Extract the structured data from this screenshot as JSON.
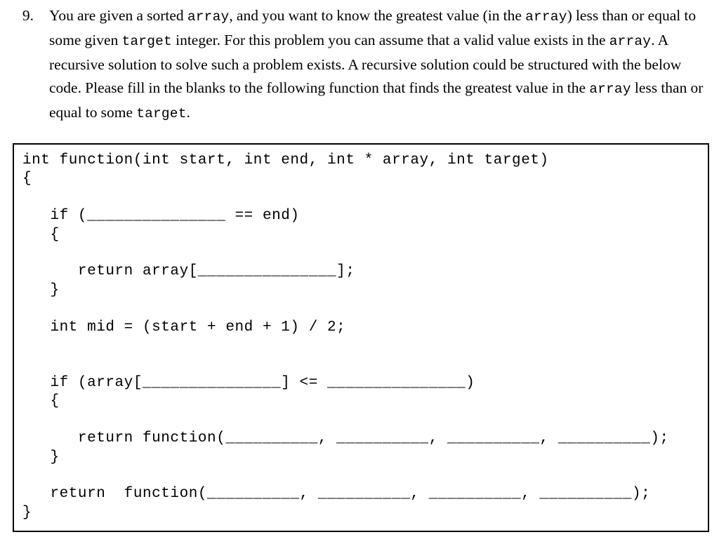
{
  "question": {
    "number": "9.",
    "segments": [
      {
        "type": "text",
        "value": "You are given a sorted "
      },
      {
        "type": "code",
        "value": "array"
      },
      {
        "type": "text",
        "value": ", and you want to know the greatest value (in the "
      },
      {
        "type": "code",
        "value": "array"
      },
      {
        "type": "text",
        "value": ") less than or equal to some given "
      },
      {
        "type": "code",
        "value": "target"
      },
      {
        "type": "text",
        "value": " integer. For this problem you can assume that a valid value exists in the "
      },
      {
        "type": "code",
        "value": "array"
      },
      {
        "type": "text",
        "value": ". A recursive solution to solve such a problem exists. A recursive solution could be structured with the below code. Please fill in the blanks to the following function that finds the greatest value in the "
      },
      {
        "type": "code",
        "value": "array"
      },
      {
        "type": "text",
        "value": " less than or equal to some "
      },
      {
        "type": "code",
        "value": "target"
      },
      {
        "type": "text",
        "value": "."
      }
    ],
    "plain_text": "You are given a sorted array, and you want to know the greatest value (in the array) less than or equal to some given target integer. For this problem you can assume that a valid value exists in the array. A recursive solution to solve such a problem exists. A recursive solution could be structured with the below code. Please fill in the blanks to the following function that finds the greatest value in the array less than or equal to some target."
  },
  "code_block": {
    "language": "C",
    "lines": [
      "int function(int start, int end, int * array, int target)",
      "{",
      "",
      "   if (_______________ == end)",
      "   {",
      "",
      "      return array[_______________];",
      "   }",
      "",
      "   int mid = (start + end + 1) / 2;",
      "",
      "",
      "   if (array[_______________] <= _______________)",
      "   {",
      "",
      "      return function(__________, __________, __________, __________);",
      "   }",
      "",
      "   return  function(__________, __________, __________, __________);",
      "}"
    ],
    "blank_counts": {
      "if_condition_left": 1,
      "return_array_index": 1,
      "if_array_index": 1,
      "if_compare_right": 1,
      "first_recursive_call_args": 4,
      "second_recursive_call_args": 4
    },
    "border_color": "#000000",
    "text_color": "#000000",
    "background_color": "#ffffff"
  }
}
